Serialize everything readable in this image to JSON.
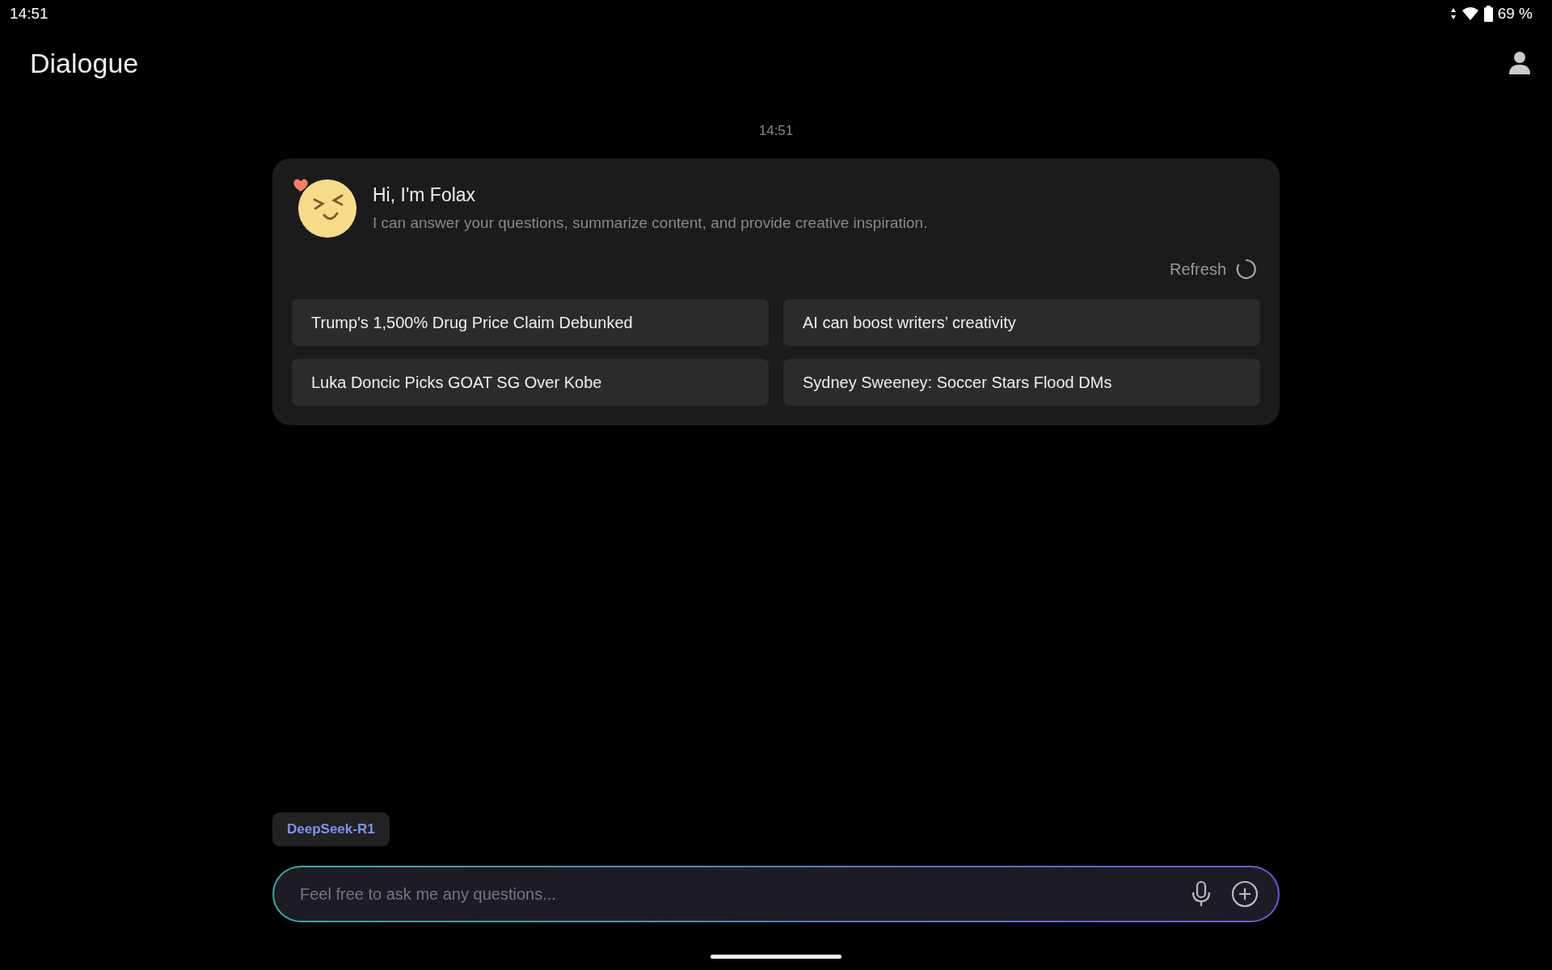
{
  "status_bar": {
    "time": "14:51",
    "battery": "69 %"
  },
  "header": {
    "title": "Dialogue"
  },
  "chat": {
    "timestamp": "14:51",
    "welcome": {
      "title": "Hi, I'm Folax",
      "subtitle": "I can answer your questions, summarize content, and provide creative inspiration."
    },
    "refresh": "Refresh",
    "suggestions": [
      "Trump's 1,500% Drug Price Claim Debunked",
      "AI can boost writers’ creativity",
      "Luka Doncic Picks GOAT SG Over Kobe",
      "Sydney Sweeney: Soccer Stars Flood DMs"
    ]
  },
  "composer": {
    "model": "DeepSeek-R1",
    "placeholder": "Feel free to ask me any questions..."
  }
}
